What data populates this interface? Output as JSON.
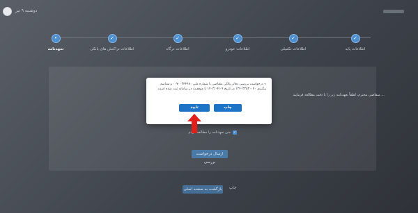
{
  "header": {
    "date": "دوشنبه ۹ تیر"
  },
  "steps": [
    {
      "label": "تعهدنامه",
      "active": true,
      "done": false
    },
    {
      "label": "اطلاعات تراکنش های بانکی",
      "active": false,
      "done": true
    },
    {
      "label": "اطلاعات درگاه",
      "active": false,
      "done": true
    },
    {
      "label": "اطلاعات خودرو",
      "active": false,
      "done": true
    },
    {
      "label": "اطلاعات تکمیلی",
      "active": false,
      "done": true
    },
    {
      "label": "اطلاعات پایه",
      "active": false,
      "done": true
    }
  ],
  "content": {
    "intro": "متقاضی محترم، لطفاً تعهدنامه زیر را با دقت مطالعه فرمایید ...",
    "agree_label": "متن تعهدنامه را مطالعه کردم",
    "submit_label": "ارسال درخواست بررسی",
    "back_label": "بازگشت به صفحه اصلی",
    "print_label": "چاپ"
  },
  "modal": {
    "message": "» درخواست بررسی دفاتر پلاکی متقاضی با شماره ملی ۰۰۷۰۰۳۴۴۴۸۰ و شناسه پیگیری ۱۳۴۰۳۳۵۳۰۰۴۰ در تاریخ ۱۴۰۳/۰۴/۰۹ با موفقیت در سامانه ثبت شده است.",
    "confirm_label": "تایید",
    "print_label": "چاپ"
  },
  "colors": {
    "primary": "#1d74c6",
    "annotation_arrow": "#e0201b"
  }
}
